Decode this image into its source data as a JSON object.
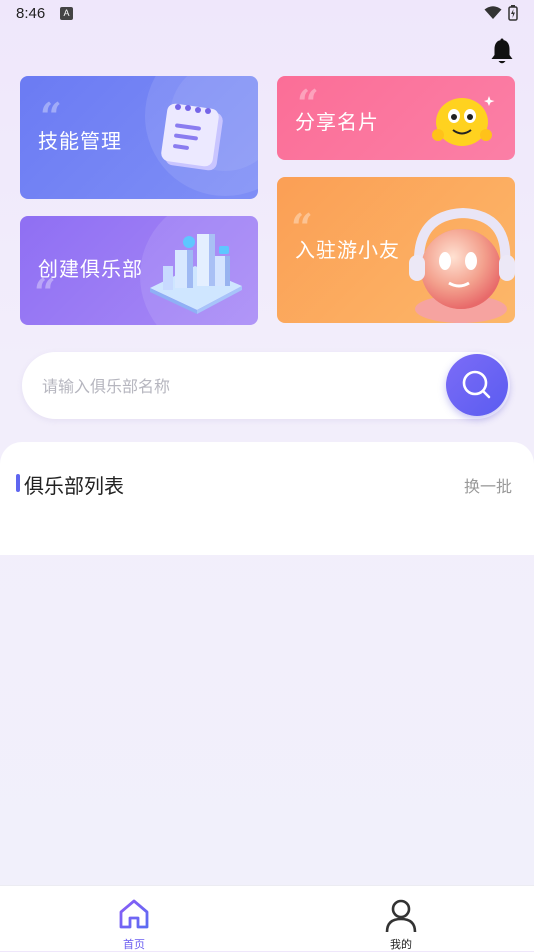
{
  "status_bar": {
    "time": "8:46",
    "notification_glyph": "A"
  },
  "cards": {
    "skill": {
      "label": "技能管理"
    },
    "share": {
      "label": "分享名片"
    },
    "club": {
      "label": "创建俱乐部"
    },
    "join": {
      "label": "入驻游小友"
    }
  },
  "search": {
    "placeholder": "请输入俱乐部名称",
    "value": ""
  },
  "club_list": {
    "title": "俱乐部列表",
    "refresh_label": "换一批"
  },
  "tabbar": {
    "home": {
      "label": "首页",
      "color": "#6a5cf0"
    },
    "me": {
      "label": "我的",
      "color": "#222222"
    }
  },
  "colors": {
    "accent": "#5f66f0"
  }
}
